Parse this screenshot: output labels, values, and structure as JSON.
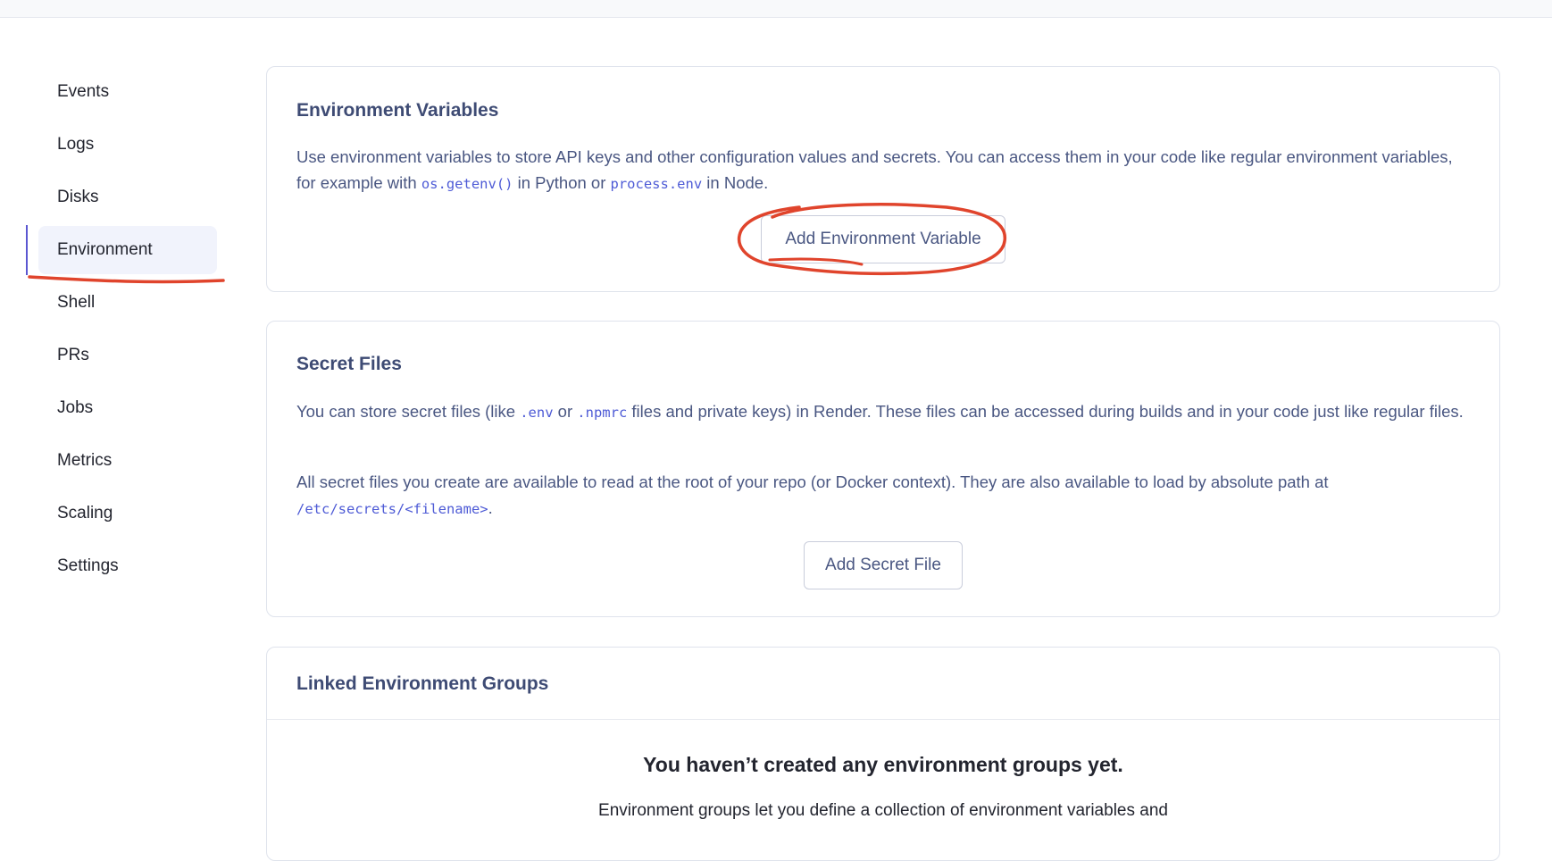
{
  "sidebar": {
    "items": [
      {
        "label": "Events"
      },
      {
        "label": "Logs"
      },
      {
        "label": "Disks"
      },
      {
        "label": "Environment"
      },
      {
        "label": "Shell"
      },
      {
        "label": "PRs"
      },
      {
        "label": "Jobs"
      },
      {
        "label": "Metrics"
      },
      {
        "label": "Scaling"
      },
      {
        "label": "Settings"
      }
    ],
    "active": "Environment"
  },
  "env_vars": {
    "title": "Environment Variables",
    "desc_part1": "Use environment variables to store API keys and other configuration values and secrets. You can access them in your code like regular environment variables, for example with ",
    "code1": "os.getenv()",
    "desc_part2": " in Python or ",
    "code2": "process.env",
    "desc_part3": " in Node.",
    "button_label": "Add Environment Variable"
  },
  "secret_files": {
    "title": "Secret Files",
    "p1_part1": "You can store secret files (like ",
    "p1_code1": ".env",
    "p1_part2": " or ",
    "p1_code2": ".npmrc",
    "p1_part3": " files and private keys) in Render. These files can be accessed during builds and in your code just like regular files.",
    "p2_part1": "All secret files you create are available to read at the root of your repo (or Docker context). They are also available to load by absolute path at ",
    "p2_code": "/etc/secrets/<filename>",
    "p2_part2": ".",
    "button_label": "Add Secret File"
  },
  "linked_groups": {
    "title": "Linked Environment Groups",
    "empty_title": "You haven’t created any environment groups yet.",
    "empty_desc": "Environment groups let you define a collection of environment variables and"
  },
  "colors": {
    "accent": "#5b57d1",
    "annotation": "#e0442c",
    "heading": "#3e4b74",
    "code": "#4e5bd6"
  }
}
